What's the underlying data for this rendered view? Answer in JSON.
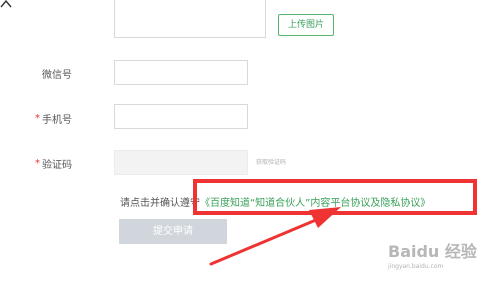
{
  "form": {
    "upload_button": "上传图片",
    "fields": {
      "wechat_label": "微信号",
      "phone_label": "手机号",
      "code_label": "验证码",
      "required_mark": "*"
    },
    "code_button": "获取验证码",
    "agreement_prefix": "请点击并确认遵守",
    "agreement_link": "《百度知道“知道合伙人”内容平台协议及隐私协议》",
    "submit_button": "提交申请"
  },
  "watermark": {
    "logo_text": "Baidu 经验",
    "url": "jingyan.baidu.com"
  },
  "colors": {
    "accent_green": "#3aa05a",
    "highlight_red": "#ef3333",
    "required_red": "#e63333",
    "disabled_button": "#d0d6dc"
  }
}
